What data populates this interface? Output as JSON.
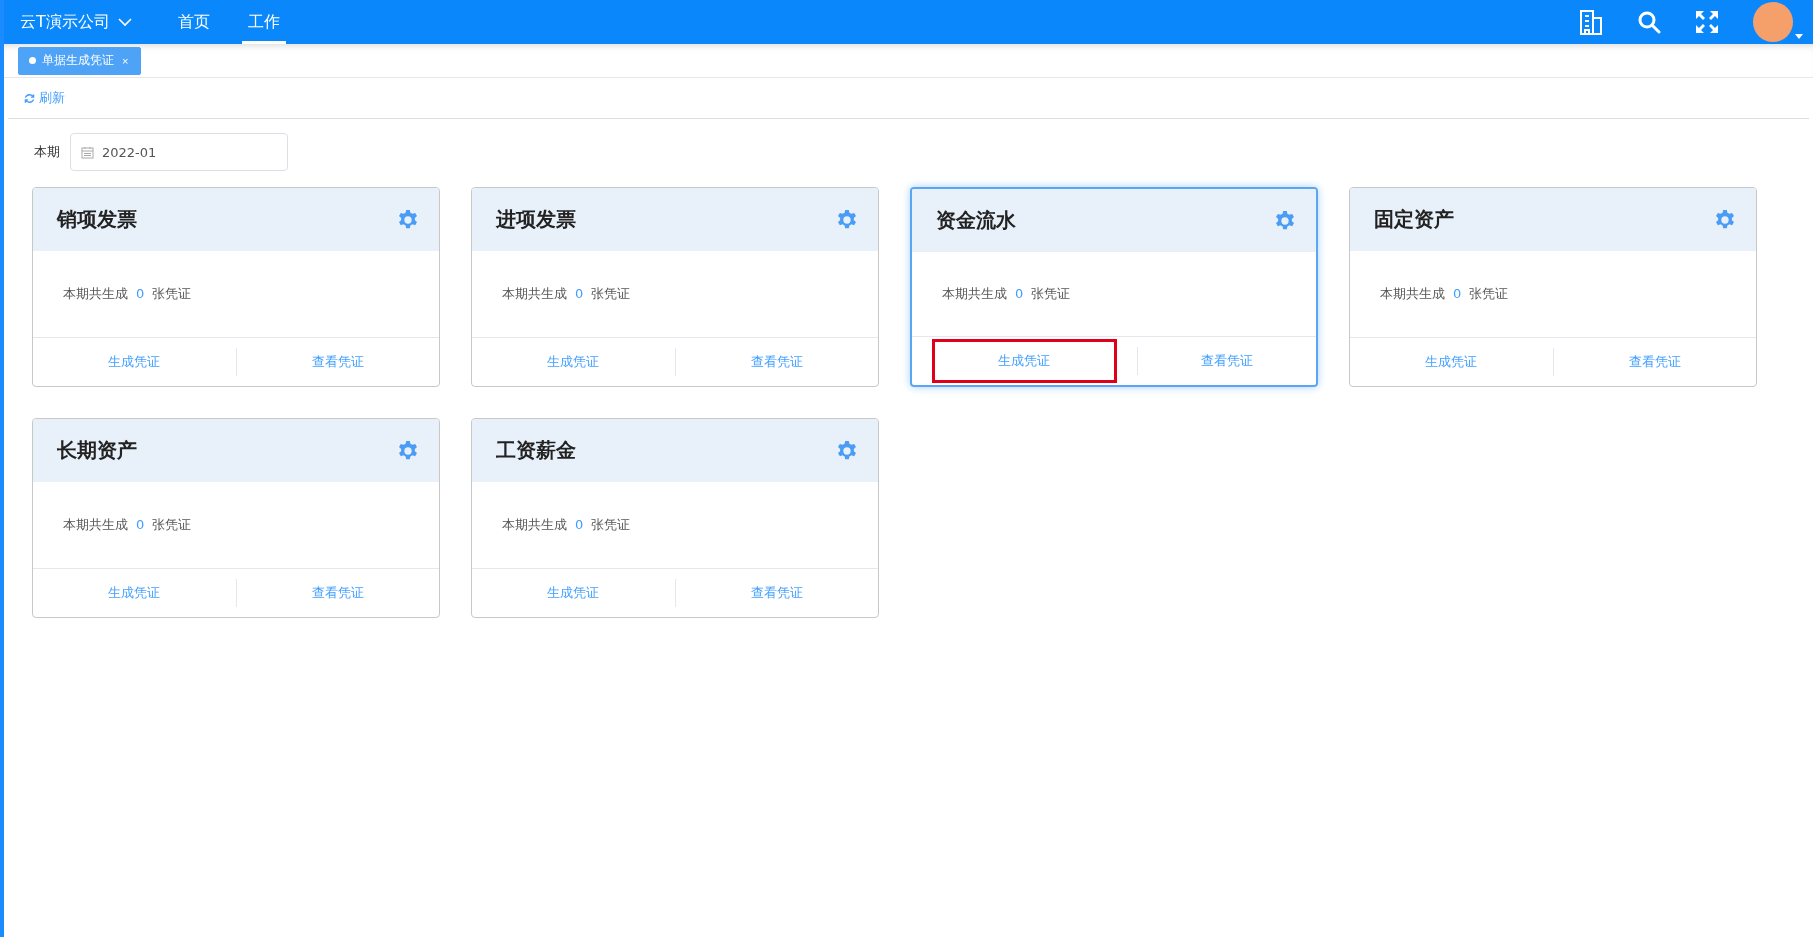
{
  "header": {
    "company": "云T演示公司",
    "nav": [
      {
        "label": "首页",
        "selected": false
      },
      {
        "label": "工作",
        "selected": true
      }
    ]
  },
  "tabs": [
    {
      "label": "单据生成凭证",
      "selected": true,
      "close": "×"
    }
  ],
  "toolbar": {
    "refresh": "刷新"
  },
  "period": {
    "label": "本期",
    "value": "2022-01"
  },
  "cards": [
    {
      "title": "销项发票",
      "summary_prefix": "本期共生成",
      "count": "0",
      "summary_suffix": "张凭证",
      "active": false,
      "actions": [
        {
          "label": "生成凭证",
          "highlighted": false
        },
        {
          "label": "查看凭证",
          "highlighted": false
        }
      ]
    },
    {
      "title": "进项发票",
      "summary_prefix": "本期共生成",
      "count": "0",
      "summary_suffix": "张凭证",
      "active": false,
      "actions": [
        {
          "label": "生成凭证",
          "highlighted": false
        },
        {
          "label": "查看凭证",
          "highlighted": false
        }
      ]
    },
    {
      "title": "资金流水",
      "summary_prefix": "本期共生成",
      "count": "0",
      "summary_suffix": "张凭证",
      "active": true,
      "actions": [
        {
          "label": "生成凭证",
          "highlighted": true
        },
        {
          "label": "查看凭证",
          "highlighted": false
        }
      ]
    },
    {
      "title": "固定资产",
      "summary_prefix": "本期共生成",
      "count": "0",
      "summary_suffix": "张凭证",
      "active": false,
      "actions": [
        {
          "label": "生成凭证",
          "highlighted": false
        },
        {
          "label": "查看凭证",
          "highlighted": false
        }
      ]
    },
    {
      "title": "长期资产",
      "summary_prefix": "本期共生成",
      "count": "0",
      "summary_suffix": "张凭证",
      "active": false,
      "actions": [
        {
          "label": "生成凭证",
          "highlighted": false
        },
        {
          "label": "查看凭证",
          "highlighted": false
        }
      ]
    },
    {
      "title": "工资薪金",
      "summary_prefix": "本期共生成",
      "count": "0",
      "summary_suffix": "张凭证",
      "active": false,
      "actions": [
        {
          "label": "生成凭证",
          "highlighted": false
        },
        {
          "label": "查看凭证",
          "highlighted": false
        }
      ]
    }
  ]
}
